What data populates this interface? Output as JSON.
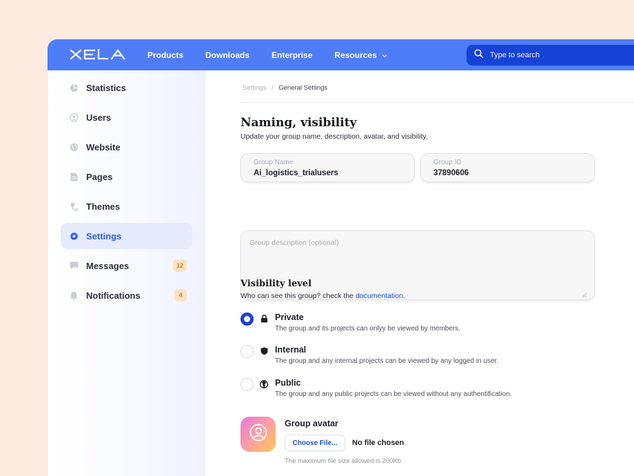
{
  "brand": {
    "logo_text": "XELA"
  },
  "topnav": {
    "links": [
      "Products",
      "Downloads",
      "Enterprise",
      "Resources"
    ],
    "search_placeholder": "Type to search"
  },
  "sidebar": {
    "items": [
      {
        "label": "Statistics",
        "icon": "chart-pie-icon",
        "badge": ""
      },
      {
        "label": "Users",
        "icon": "user-icon",
        "badge": ""
      },
      {
        "label": "Website",
        "icon": "globe-icon",
        "badge": ""
      },
      {
        "label": "Pages",
        "icon": "document-icon",
        "badge": ""
      },
      {
        "label": "Themes",
        "icon": "brush-icon",
        "badge": ""
      },
      {
        "label": "Settings",
        "icon": "gear-icon",
        "badge": "",
        "active": true
      },
      {
        "label": "Messages",
        "icon": "chat-icon",
        "badge": "12"
      },
      {
        "label": "Notifications",
        "icon": "bell-icon",
        "badge": "4"
      }
    ]
  },
  "breadcrumb": {
    "parent": "Settings",
    "separator": "/",
    "current": "General Settings"
  },
  "naming": {
    "title": "Naming, visibility",
    "subtitle": "Update your group name, description, avatar, and visibility.",
    "group_name_label": "Group Name",
    "group_name_value": "Ai_logistics_trialusers",
    "group_id_label": "Group ID",
    "group_id_value": "37890606",
    "description_placeholder": "Group description (optional)"
  },
  "visibility": {
    "title": "Visibility level",
    "subtitle_prefix": "Who can see this group? check the ",
    "subtitle_link": "documentation",
    "subtitle_suffix": ".",
    "options": [
      {
        "title": "Private",
        "desc": "The group and its projects can onlyy be viewed by members.",
        "icon": "lock-icon",
        "selected": true
      },
      {
        "title": "Internal",
        "desc": "The group and any internal projects can be viewed by any logged in user.",
        "icon": "shield-icon",
        "selected": false
      },
      {
        "title": "Public",
        "desc": "The group and any public projects can be viewed without any authentification.",
        "icon": "globe-icon",
        "selected": false
      }
    ]
  },
  "avatar": {
    "title": "Group avatar",
    "choose_label": "Choose File...",
    "no_file": "No file chosen",
    "hint": "The maximum file size allowed is 200Kb"
  },
  "colors": {
    "primary": "#4f7cf7",
    "search_bg": "#1742d6",
    "radio_on": "#1c3fd8",
    "badge_bg": "#fde2c4",
    "badge_text": "#d67c2a"
  }
}
